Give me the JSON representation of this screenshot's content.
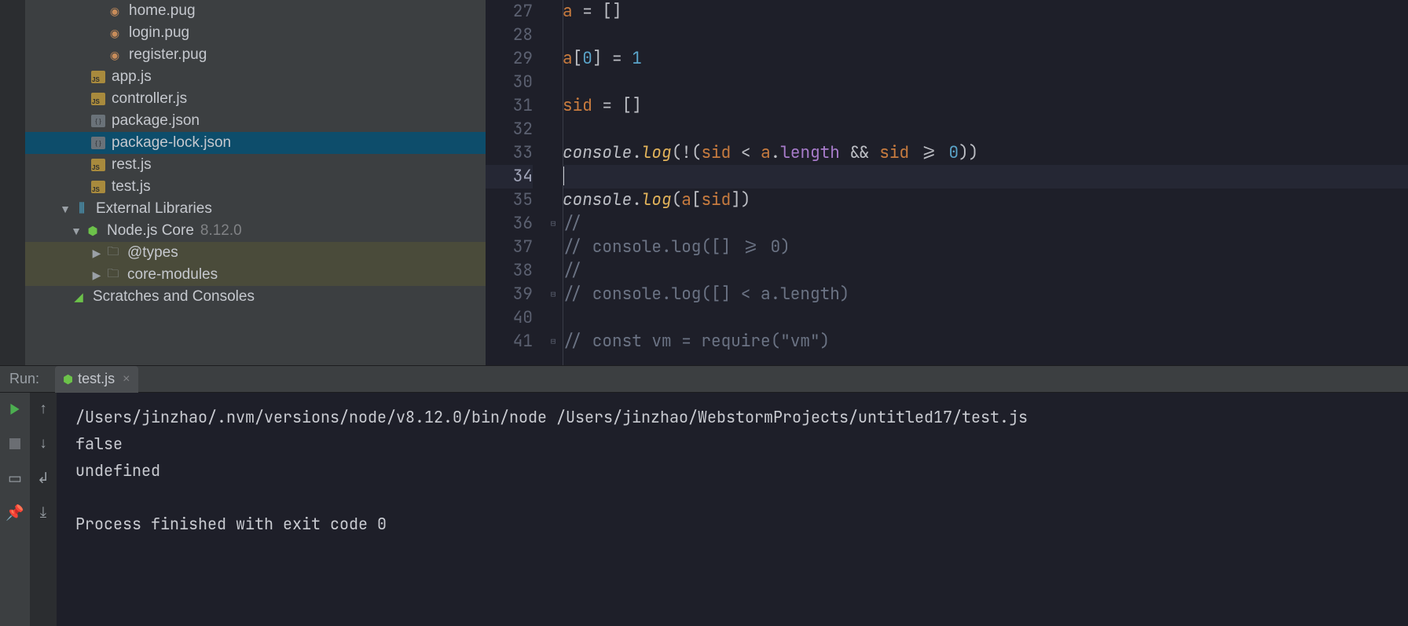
{
  "tree": {
    "items": [
      {
        "label": "home.pug",
        "icon": "pug",
        "indent": "indent-3"
      },
      {
        "label": "login.pug",
        "icon": "pug",
        "indent": "indent-3"
      },
      {
        "label": "register.pug",
        "icon": "pug",
        "indent": "indent-3"
      },
      {
        "label": "app.js",
        "icon": "js",
        "indent": "indent-2"
      },
      {
        "label": "controller.js",
        "icon": "js",
        "indent": "indent-2"
      },
      {
        "label": "package.json",
        "icon": "json",
        "indent": "indent-2"
      },
      {
        "label": "package-lock.json",
        "icon": "json",
        "indent": "indent-2",
        "selected": true
      },
      {
        "label": "rest.js",
        "icon": "js",
        "indent": "indent-2"
      },
      {
        "label": "test.js",
        "icon": "js",
        "indent": "indent-2"
      }
    ],
    "external": {
      "label": "External Libraries",
      "node": {
        "label": "Node.js Core",
        "version": "8.12.0"
      },
      "types": "@types",
      "core": "core-modules"
    },
    "scratches": "Scratches and Consoles"
  },
  "editor": {
    "lines": [
      27,
      28,
      29,
      30,
      31,
      32,
      33,
      34,
      35,
      36,
      37,
      38,
      39,
      40,
      41
    ],
    "current": 34,
    "code": {
      "l27": {
        "a": "a",
        "eq": " = ",
        "br": "[]"
      },
      "l29": {
        "a": "a",
        "lb": "[",
        "n0": "0",
        "rb": "]",
        "eq": " = ",
        "n1": "1"
      },
      "l31": {
        "sid": "sid",
        "eq": " = ",
        "br": "[]"
      },
      "l33": {
        "cons": "console",
        "dot": ".",
        "log": "log",
        "open": "(!(",
        "sid1": "sid",
        "lt": " < ",
        "a": "a",
        "dot2": ".",
        "len": "length",
        "and": " && ",
        "sid2": "sid",
        "ge": " >= ",
        "zero": "0",
        "close": "))"
      },
      "l35": {
        "cons": "console",
        "dot": ".",
        "log": "log",
        "open": "(",
        "a": "a",
        "lb": "[",
        "sid": "sid",
        "rb": "]",
        ")": ")"
      },
      "l36": "//",
      "l37": "// console.log([] >= 0)",
      "l38": "//",
      "l39": "// console.log([] < a.length)",
      "l41": "// const vm = require(\"vm\")"
    }
  },
  "run": {
    "title": "Run:",
    "tab": "test.js",
    "console_lines": [
      "/Users/jinzhao/.nvm/versions/node/v8.12.0/bin/node /Users/jinzhao/WebstormProjects/untitled17/test.js",
      "false",
      "undefined",
      "",
      "Process finished with exit code 0"
    ]
  }
}
